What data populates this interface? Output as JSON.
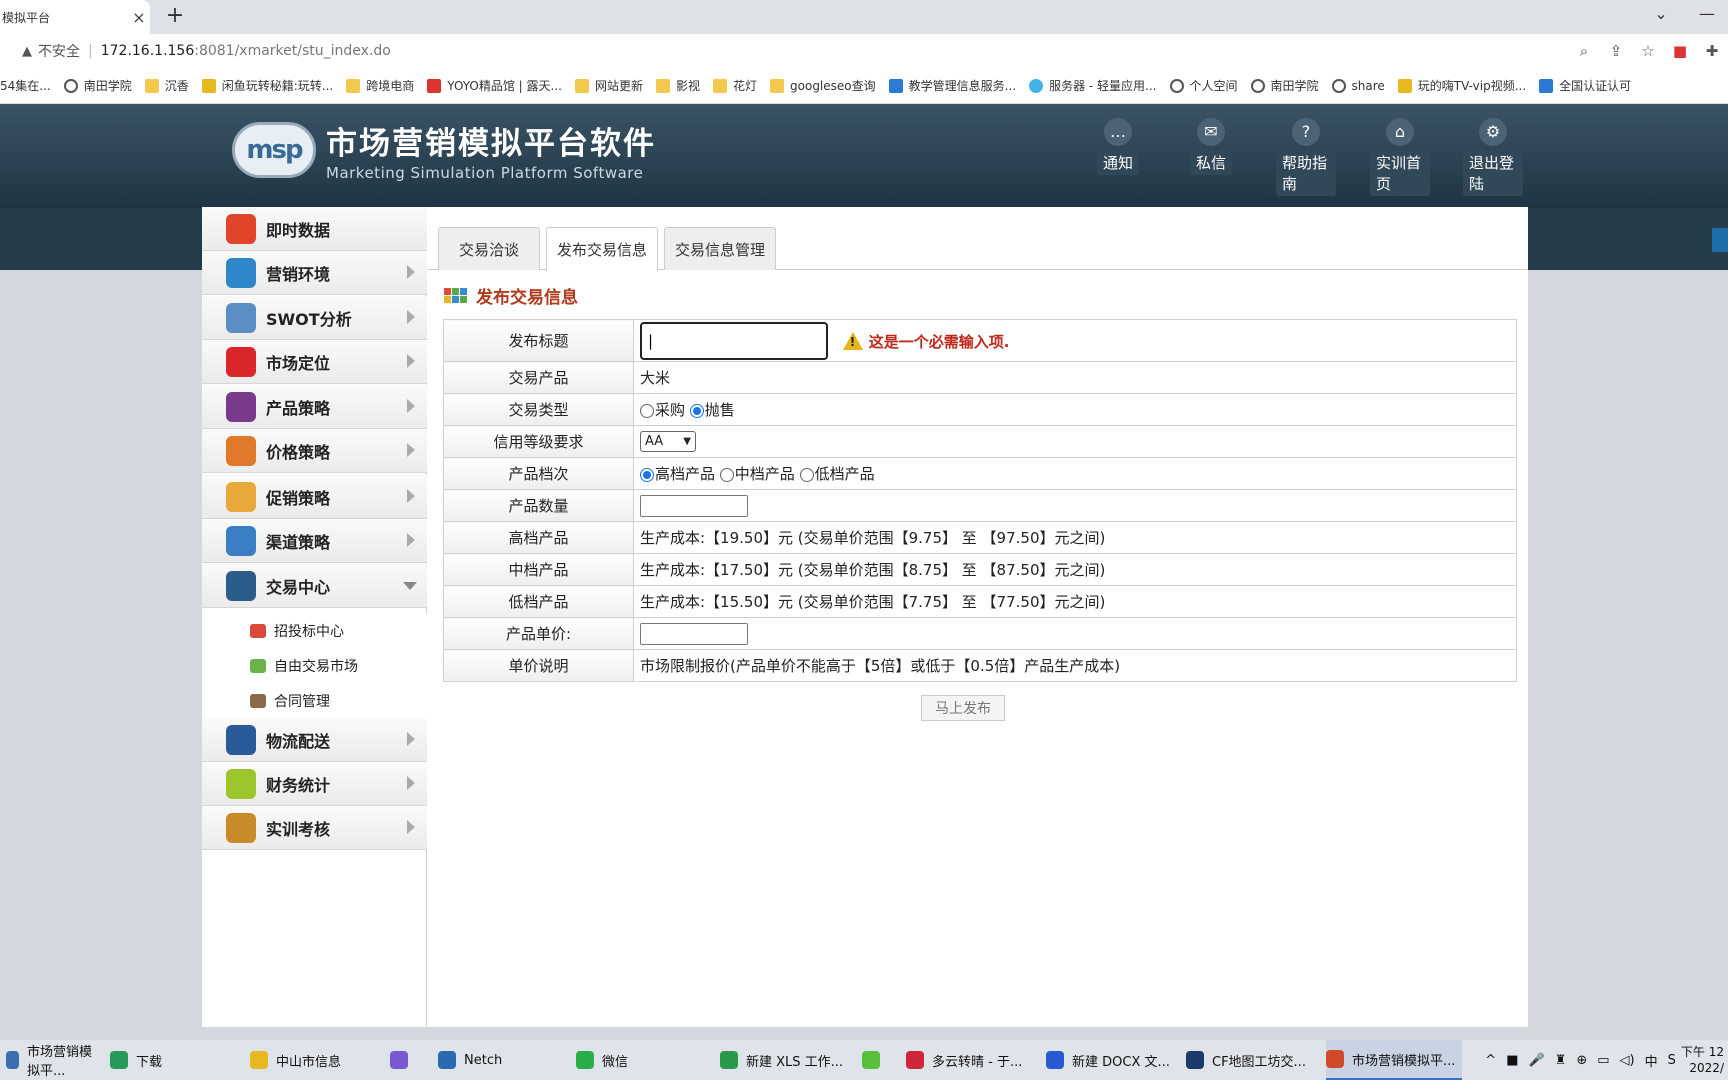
{
  "browser": {
    "tab_title": "模拟平台",
    "tab_close": "×",
    "new_tab": "+",
    "window_controls": [
      "⌄",
      "—"
    ],
    "security_label": "不安全",
    "url_host": "172.16.1.156",
    "url_rest": ":8081/xmarket/stu_index.do",
    "bookmarks": [
      {
        "label": "54集在...",
        "icon": "none"
      },
      {
        "label": "南田学院",
        "icon": "globe"
      },
      {
        "label": "沉香",
        "icon": "folder"
      },
      {
        "label": "闲鱼玩转秘籍:玩转...",
        "icon": "yellow"
      },
      {
        "label": "跨境电商",
        "icon": "folder"
      },
      {
        "label": "YOYO精品馆 | 露天...",
        "icon": "red"
      },
      {
        "label": "网站更新",
        "icon": "folder"
      },
      {
        "label": "影视",
        "icon": "folder"
      },
      {
        "label": "花灯",
        "icon": "folder"
      },
      {
        "label": "googleseo查询",
        "icon": "folder"
      },
      {
        "label": "教学管理信息服务...",
        "icon": "blue"
      },
      {
        "label": "服务器 - 轻量应用...",
        "icon": "cloud"
      },
      {
        "label": "个人空间",
        "icon": "globe"
      },
      {
        "label": "南田学院",
        "icon": "globe"
      },
      {
        "label": "share",
        "icon": "globe"
      },
      {
        "label": "玩的嗨TV-vip视频...",
        "icon": "yellow"
      },
      {
        "label": "全国认证认可",
        "icon": "blue"
      }
    ]
  },
  "app": {
    "title_cn": "市场营销模拟平台软件",
    "title_en": "Marketing Simulation Platform Software",
    "logo_text": "msp",
    "topnav": [
      {
        "label": "通知",
        "glyph": "…",
        "icon": "chat-icon"
      },
      {
        "label": "私信",
        "glyph": "✉",
        "icon": "mail-icon"
      },
      {
        "label": "帮助指南",
        "glyph": "?",
        "icon": "help-icon"
      },
      {
        "label": "实训首页",
        "glyph": "⌂",
        "icon": "home-icon"
      },
      {
        "label": "退出登陆",
        "glyph": "⚙",
        "icon": "gear-icon"
      }
    ]
  },
  "sidebar": {
    "items": [
      {
        "label": "即时数据",
        "color": "#e0452a",
        "arrow": false
      },
      {
        "label": "营销环境",
        "color": "#2f86c9",
        "arrow": true
      },
      {
        "label": "SWOT分析",
        "color": "#5b8ec4",
        "arrow": true
      },
      {
        "label": "市场定位",
        "color": "#d9262b",
        "arrow": true
      },
      {
        "label": "产品策略",
        "color": "#7a3a8c",
        "arrow": true
      },
      {
        "label": "价格策略",
        "color": "#e07a2a",
        "arrow": true
      },
      {
        "label": "促销策略",
        "color": "#e8a93a",
        "arrow": true
      },
      {
        "label": "渠道策略",
        "color": "#3a7fc4",
        "arrow": true
      },
      {
        "label": "交易中心",
        "color": "#2c5d8a",
        "arrow": "down"
      }
    ],
    "subitems": [
      {
        "label": "招投标中心",
        "color": "#d84a3a"
      },
      {
        "label": "自由交易市场",
        "color": "#6bb34a"
      },
      {
        "label": "合同管理",
        "color": "#8a6a4a"
      }
    ],
    "items_after": [
      {
        "label": "物流配送",
        "color": "#2a5a9a"
      },
      {
        "label": "财务统计",
        "color": "#9bc52a"
      },
      {
        "label": "实训考核",
        "color": "#c98a2a"
      }
    ]
  },
  "content": {
    "tabs": [
      "交易洽谈",
      "发布交易信息",
      "交易信息管理"
    ],
    "active_tab": 1,
    "section_title": "发布交易信息",
    "form": {
      "title_label": "发布标题",
      "title_value": "|",
      "required_warning": "这是一个必需输入项.",
      "product_label": "交易产品",
      "product_value": "大米",
      "type_label": "交易类型",
      "type_options": [
        "采购",
        "抛售"
      ],
      "type_selected": 1,
      "credit_label": "信用等级要求",
      "credit_value": "AA",
      "grade_label": "产品档次",
      "grade_options": [
        "高档产品",
        "中档产品",
        "低档产品"
      ],
      "grade_selected": 0,
      "qty_label": "产品数量",
      "high_label": "高档产品",
      "high_value": "生产成本:【19.50】元 (交易单价范围【9.75】 至 【97.50】元之间)",
      "mid_label": "中档产品",
      "mid_value": "生产成本:【17.50】元 (交易单价范围【8.75】 至 【87.50】元之间)",
      "low_label": "低档产品",
      "low_value": "生产成本:【15.50】元 (交易单价范围【7.75】 至 【77.50】元之间)",
      "price_label": "产品单价:",
      "note_label": "单价说明",
      "note_value": "市场限制报价(产品单价不能高于【5倍】或低于【0.5倍】产品生产成本)"
    },
    "publish_button": "马上发布"
  },
  "taskbar": {
    "items": [
      {
        "label": "市场营销模拟平...",
        "color": "#3a6fb0"
      },
      {
        "label": "下载",
        "color": "#2a9a5a"
      },
      {
        "label": "中山市信息",
        "color": "#e8b820"
      },
      {
        "label": "",
        "color": "#7a5ad0"
      },
      {
        "label": "Netch",
        "color": "#2a6ab0"
      },
      {
        "label": "微信",
        "color": "#2aae4a"
      },
      {
        "label": "新建 XLS 工作...",
        "color": "#2a9a4a"
      },
      {
        "label": "",
        "color": "#5abf3a"
      },
      {
        "label": "多云转晴 - 于...",
        "color": "#d0263a"
      },
      {
        "label": "新建 DOCX 文...",
        "color": "#2a5ad0"
      },
      {
        "label": "CF地图工坊交...",
        "color": "#1a3a6a"
      },
      {
        "label": "市场营销模拟平...",
        "color": "#d04a2a"
      }
    ],
    "tray_icons": [
      "^",
      "■",
      "🎤",
      "♜",
      "⊕",
      "▭",
      "◁)",
      "中",
      "S"
    ],
    "time": "下午 12",
    "date": "2022/"
  }
}
